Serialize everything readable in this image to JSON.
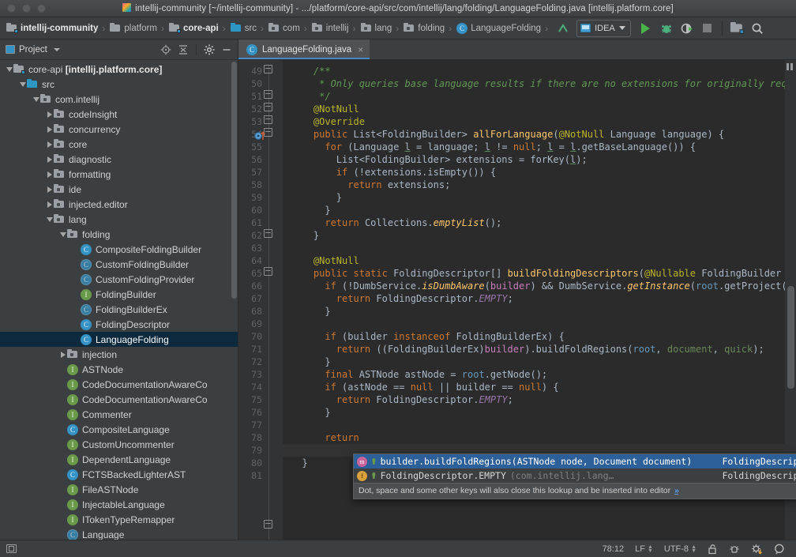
{
  "window": {
    "title": "intellij-community [~/intellij-community] - .../platform/core-api/src/com/intellij/lang/folding/LanguageFolding.java [intellij.platform.core]",
    "app_icon": "intellij-idea-icon"
  },
  "navbar": {
    "breadcrumbs": [
      {
        "label": "intellij-community",
        "icon": "module-icon",
        "bold": true
      },
      {
        "label": "platform",
        "icon": "folder-icon",
        "bold": false
      },
      {
        "label": "core-api",
        "icon": "module-icon",
        "bold": true
      },
      {
        "label": "src",
        "icon": "source-folder-icon",
        "bold": false
      },
      {
        "label": "com",
        "icon": "package-icon",
        "bold": false
      },
      {
        "label": "intellij",
        "icon": "package-icon",
        "bold": false
      },
      {
        "label": "lang",
        "icon": "package-icon",
        "bold": false
      },
      {
        "label": "folding",
        "icon": "package-icon",
        "bold": false
      },
      {
        "label": "LanguageFolding",
        "icon": "class-icon",
        "bold": false
      }
    ],
    "separator": "›",
    "run_config": {
      "label": "IDEA",
      "icon": "run-config-icon"
    },
    "buttons": [
      {
        "name": "build-icon",
        "label": ""
      },
      {
        "name": "run-icon",
        "label": ""
      },
      {
        "name": "debug-icon",
        "label": ""
      },
      {
        "name": "run-with-coverage-icon",
        "label": ""
      },
      {
        "name": "stop-icon",
        "label": ""
      },
      {
        "name": "project-structure-icon",
        "label": ""
      },
      {
        "name": "search-everywhere-icon",
        "label": ""
      }
    ]
  },
  "project_panel": {
    "title": "Project",
    "actions": [
      "locate-icon",
      "collapse-all-icon",
      "settings-icon",
      "hide-icon"
    ],
    "tree": [
      {
        "depth": 0,
        "twisty": "down",
        "icon": "module-icon",
        "label": "core-api ",
        "bold_suffix": "[intellij.platform.core]",
        "selected": false
      },
      {
        "depth": 1,
        "twisty": "down",
        "icon": "source-folder-icon",
        "label": "src",
        "selected": false
      },
      {
        "depth": 2,
        "twisty": "down",
        "icon": "package-icon",
        "label": "com.intellij",
        "selected": false
      },
      {
        "depth": 3,
        "twisty": "right",
        "icon": "package-icon",
        "label": "codeInsight",
        "selected": false
      },
      {
        "depth": 3,
        "twisty": "right",
        "icon": "package-icon",
        "label": "concurrency",
        "selected": false
      },
      {
        "depth": 3,
        "twisty": "right",
        "icon": "package-icon",
        "label": "core",
        "selected": false
      },
      {
        "depth": 3,
        "twisty": "right",
        "icon": "package-icon",
        "label": "diagnostic",
        "selected": false
      },
      {
        "depth": 3,
        "twisty": "right",
        "icon": "package-icon",
        "label": "formatting",
        "selected": false
      },
      {
        "depth": 3,
        "twisty": "right",
        "icon": "package-icon",
        "label": "ide",
        "selected": false
      },
      {
        "depth": 3,
        "twisty": "right",
        "icon": "package-icon",
        "label": "injected.editor",
        "selected": false
      },
      {
        "depth": 3,
        "twisty": "down",
        "icon": "package-icon",
        "label": "lang",
        "selected": false
      },
      {
        "depth": 4,
        "twisty": "down",
        "icon": "package-icon",
        "label": "folding",
        "selected": false
      },
      {
        "depth": 5,
        "twisty": "none",
        "icon": "class-icon",
        "label": "CompositeFoldingBuilder",
        "selected": false
      },
      {
        "depth": 5,
        "twisty": "none",
        "icon": "abstract-class-icon",
        "label": "CustomFoldingBuilder",
        "selected": false
      },
      {
        "depth": 5,
        "twisty": "none",
        "icon": "abstract-class-icon",
        "label": "CustomFoldingProvider",
        "selected": false
      },
      {
        "depth": 5,
        "twisty": "none",
        "icon": "interface-icon",
        "label": "FoldingBuilder",
        "selected": false
      },
      {
        "depth": 5,
        "twisty": "none",
        "icon": "abstract-class-icon",
        "label": "FoldingBuilderEx",
        "selected": false
      },
      {
        "depth": 5,
        "twisty": "none",
        "icon": "class-icon",
        "label": "FoldingDescriptor",
        "selected": false
      },
      {
        "depth": 5,
        "twisty": "none",
        "icon": "class-icon",
        "label": "LanguageFolding",
        "selected": true
      },
      {
        "depth": 4,
        "twisty": "right",
        "icon": "package-icon",
        "label": "injection",
        "selected": false
      },
      {
        "depth": 4,
        "twisty": "none",
        "icon": "interface-icon",
        "label": "ASTNode",
        "selected": false
      },
      {
        "depth": 4,
        "twisty": "none",
        "icon": "interface-icon",
        "label": "CodeDocumentationAwareCo",
        "selected": false
      },
      {
        "depth": 4,
        "twisty": "none",
        "icon": "interface-icon",
        "label": "CodeDocumentationAwareCo",
        "selected": false
      },
      {
        "depth": 4,
        "twisty": "none",
        "icon": "interface-icon",
        "label": "Commenter",
        "selected": false
      },
      {
        "depth": 4,
        "twisty": "none",
        "icon": "class-icon",
        "label": "CompositeLanguage",
        "selected": false
      },
      {
        "depth": 4,
        "twisty": "none",
        "icon": "interface-icon",
        "label": "CustomUncommenter",
        "selected": false
      },
      {
        "depth": 4,
        "twisty": "none",
        "icon": "interface-icon",
        "label": "DependentLanguage",
        "selected": false
      },
      {
        "depth": 4,
        "twisty": "none",
        "icon": "class-icon",
        "label": "FCTSBackedLighterAST",
        "selected": false
      },
      {
        "depth": 4,
        "twisty": "none",
        "icon": "interface-icon",
        "label": "FileASTNode",
        "selected": false
      },
      {
        "depth": 4,
        "twisty": "none",
        "icon": "interface-icon",
        "label": "InjectableLanguage",
        "selected": false
      },
      {
        "depth": 4,
        "twisty": "none",
        "icon": "interface-icon",
        "label": "ITokenTypeRemapper",
        "selected": false
      },
      {
        "depth": 4,
        "twisty": "none",
        "icon": "abstract-class-icon",
        "label": "Language",
        "selected": false
      }
    ]
  },
  "editor": {
    "tab": {
      "label": "LanguageFolding.java",
      "icon": "class-icon",
      "close": "×"
    },
    "first_line_number": 49,
    "last_line_number": 81,
    "lines": [
      {
        "n": 49,
        "text": "    /**"
      },
      {
        "n": 50,
        "text": "     * Only queries base language results if there are no extensions for originally requested"
      },
      {
        "n": 51,
        "text": "     */"
      },
      {
        "n": 52,
        "text": "    @NotNull"
      },
      {
        "n": 53,
        "text": "    @Override"
      },
      {
        "n": 54,
        "text": "    public List<FoldingBuilder> allForLanguage(@NotNull Language language) {"
      },
      {
        "n": 55,
        "text": "      for (Language l = language; l != null; l = l.getBaseLanguage()) {"
      },
      {
        "n": 56,
        "text": "        List<FoldingBuilder> extensions = forKey(l);"
      },
      {
        "n": 57,
        "text": "        if (!extensions.isEmpty()) {"
      },
      {
        "n": 58,
        "text": "          return extensions;"
      },
      {
        "n": 59,
        "text": "        }"
      },
      {
        "n": 60,
        "text": "      }"
      },
      {
        "n": 61,
        "text": "      return Collections.emptyList();"
      },
      {
        "n": 62,
        "text": "    }"
      },
      {
        "n": 63,
        "text": ""
      },
      {
        "n": 64,
        "text": "    @NotNull"
      },
      {
        "n": 65,
        "text": "    public static FoldingDescriptor[] buildFoldingDescriptors(@Nullable FoldingBuilder builder"
      },
      {
        "n": 66,
        "text": "      if (!DumbService.isDumbAware(builder) && DumbService.getInstance(root.getProject()).isDum"
      },
      {
        "n": 67,
        "text": "        return FoldingDescriptor.EMPTY;"
      },
      {
        "n": 68,
        "text": "      }"
      },
      {
        "n": 69,
        "text": ""
      },
      {
        "n": 70,
        "text": "      if (builder instanceof FoldingBuilderEx) {"
      },
      {
        "n": 71,
        "text": "        return ((FoldingBuilderEx)builder).buildFoldRegions(root, document, quick);"
      },
      {
        "n": 72,
        "text": "      }"
      },
      {
        "n": 73,
        "text": "      final ASTNode astNode = root.getNode();"
      },
      {
        "n": 74,
        "text": "      if (astNode == null || builder == null) {"
      },
      {
        "n": 75,
        "text": "        return FoldingDescriptor.EMPTY;"
      },
      {
        "n": 76,
        "text": "      }"
      },
      {
        "n": 77,
        "text": ""
      },
      {
        "n": 78,
        "text": "      return "
      },
      {
        "n": 79,
        "text": "    }"
      },
      {
        "n": 80,
        "text": "  }"
      },
      {
        "n": 81,
        "text": ""
      }
    ]
  },
  "completion_popup": {
    "items": [
      {
        "icon": "method-icon",
        "visibility": "public-icon",
        "text": "builder.buildFoldRegions(ASTNode node, Document document)",
        "grey": "",
        "type": "FoldingDescriptor[]",
        "selected": true
      },
      {
        "icon": "field-icon",
        "visibility": "public-icon",
        "text": "FoldingDescriptor.EMPTY",
        "grey": "(com.intellij.lang…",
        "type": "FoldingDescriptor[]",
        "selected": false
      }
    ],
    "hint": "Dot, space and some other keys will also close this lookup and be inserted into editor",
    "hint_more": "»"
  },
  "status_bar": {
    "toggle_icon": "toggle-tool-window-icon",
    "caret_position": "78:12",
    "line_separator": "LF",
    "encoding": "UTF-8",
    "lock_icon": "unlocked-icon",
    "inspection_icon": "inspections-icon",
    "update_icon": "ide-update-icon",
    "search_icon": "magnifier-icon"
  },
  "colors": {
    "accent": "#3592c4",
    "selection": "#0d293e",
    "popup_selection": "#2d6099",
    "editor_bg": "#2b2b2b",
    "panel_bg": "#3c3f41"
  }
}
